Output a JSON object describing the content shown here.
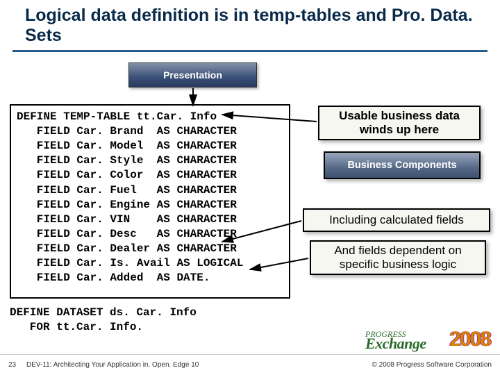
{
  "title": "Logical data definition is in temp-tables and Pro. Data. Sets",
  "presentation_label": "Presentation",
  "code_lines": "DEFINE TEMP-TABLE tt.Car. Info\n   FIELD Car. Brand  AS CHARACTER\n   FIELD Car. Model  AS CHARACTER\n   FIELD Car. Style  AS CHARACTER\n   FIELD Car. Color  AS CHARACTER\n   FIELD Car. Fuel   AS CHARACTER\n   FIELD Car. Engine AS CHARACTER\n   FIELD Car. VIN    AS CHARACTER\n   FIELD Car. Desc   AS CHARACTER\n   FIELD Car. Dealer AS CHARACTER\n   FIELD Car. Is. Avail AS LOGICAL\n   FIELD Car. Added  AS DATE.",
  "dataset_lines": "DEFINE DATASET ds. Car. Info\n   FOR tt.Car. Info.",
  "callouts": {
    "usable": "Usable business data winds up here",
    "biz": "Business Components",
    "calc": "Including calculated fields",
    "depend": "And fields dependent on specific business logic"
  },
  "footer": {
    "slide_number": "23",
    "talk_title": "DEV-11: Architecting Your Application in. Open. Edge 10",
    "copyright": "© 2008 Progress Software Corporation"
  },
  "logo": {
    "progress": "PROGRESS",
    "exchange": "Exchange",
    "year": "2008"
  }
}
